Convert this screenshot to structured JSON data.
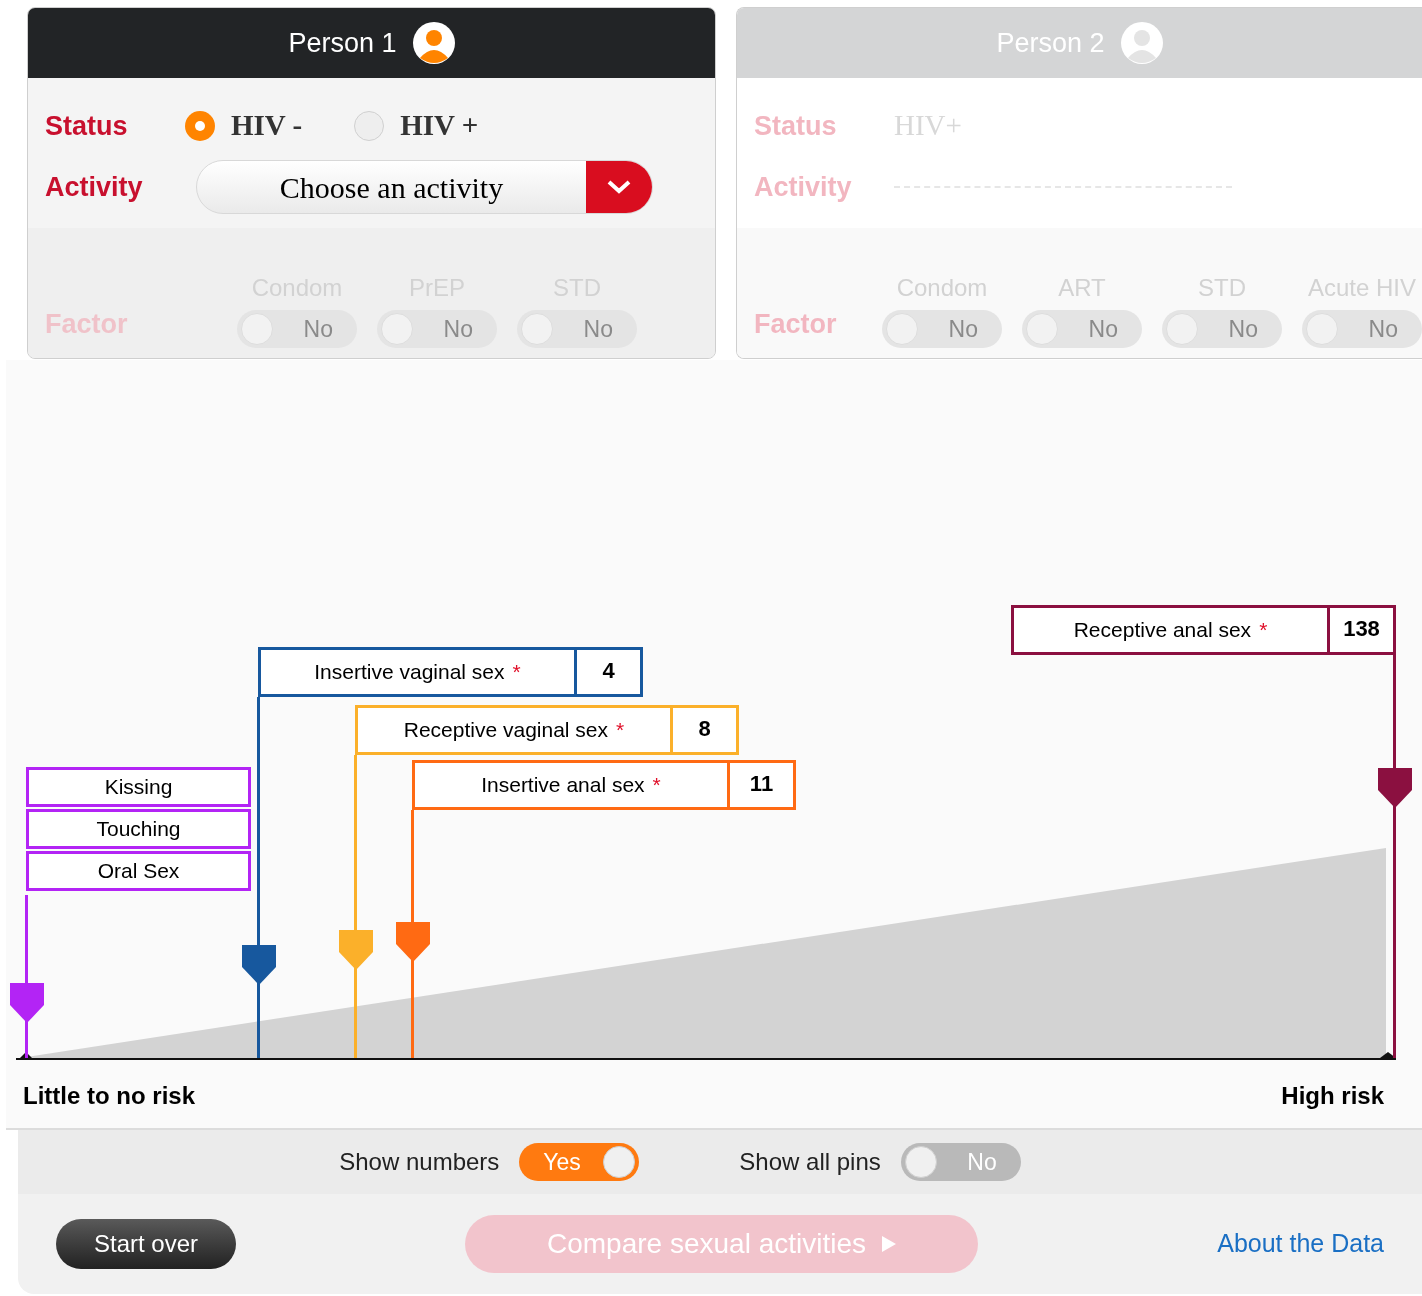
{
  "persons": [
    {
      "title": "Person 1",
      "active": true,
      "status_label": "Status",
      "status_options": [
        {
          "label": "HIV -",
          "selected": true
        },
        {
          "label": "HIV +",
          "selected": false
        }
      ],
      "activity_label": "Activity",
      "activity_select": {
        "value": "Choose an activity"
      },
      "factor_label": "Factor",
      "factors_disabled": true,
      "factors": [
        {
          "label": "Condom",
          "value": "No",
          "on": false
        },
        {
          "label": "PrEP",
          "value": "No",
          "on": false
        },
        {
          "label": "STD",
          "value": "No",
          "on": false
        }
      ]
    },
    {
      "title": "Person 2",
      "active": false,
      "status_label": "Status",
      "status_value": "HIV+",
      "activity_label": "Activity",
      "factor_label": "Factor",
      "factors_disabled": true,
      "factors": [
        {
          "label": "Condom",
          "value": "No",
          "on": false
        },
        {
          "label": "ART",
          "value": "No",
          "on": false
        },
        {
          "label": "STD",
          "value": "No",
          "on": false
        },
        {
          "label": "Acute HIV",
          "value": "No",
          "on": false
        }
      ]
    }
  ],
  "chart": {
    "pins": [
      {
        "kind": "stack",
        "color": "#b324f5",
        "labels": [
          "Kissing",
          "Touching",
          "Oral Sex"
        ]
      },
      {
        "kind": "single",
        "color": "#17589e",
        "label": "Insertive vaginal sex",
        "mark": "*",
        "count": "4"
      },
      {
        "kind": "single",
        "color": "#fbb02a",
        "label": "Receptive vaginal sex",
        "mark": "*",
        "count": "8"
      },
      {
        "kind": "single",
        "color": "#ff6a13",
        "label": "Insertive anal sex",
        "mark": "*",
        "count": "11"
      },
      {
        "kind": "single",
        "color": "#8b1040",
        "label": "Receptive anal sex",
        "mark": "*",
        "count": "138"
      }
    ],
    "low_label": "Little to no risk",
    "high_label": "High risk"
  },
  "toggles": [
    {
      "label": "Show numbers",
      "value": "Yes",
      "on": true
    },
    {
      "label": "Show all pins",
      "value": "No",
      "on": false
    }
  ],
  "footer": {
    "start_over": "Start over",
    "compare": {
      "label": "Compare sexual activities",
      "disabled": true
    },
    "link": "About the Data"
  }
}
